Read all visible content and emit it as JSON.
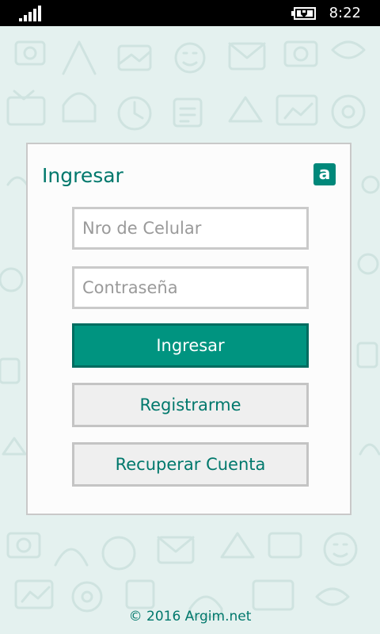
{
  "status_bar": {
    "time": "8:22",
    "signal_icon": "signal-bars-icon",
    "battery_icon": "battery-charging-icon"
  },
  "login": {
    "title": "Ingresar",
    "logo_letter": "a",
    "phone_placeholder": "Nro de Celular",
    "password_placeholder": "Contraseña",
    "submit_label": "Ingresar",
    "register_label": "Registrarme",
    "recover_label": "Recuperar Cuenta"
  },
  "footer": {
    "copyright": "© 2016 Argim.net"
  },
  "colors": {
    "accent": "#009480",
    "accent_dark": "#006c60",
    "text_accent": "#00786c",
    "background": "#e4f1ef"
  }
}
